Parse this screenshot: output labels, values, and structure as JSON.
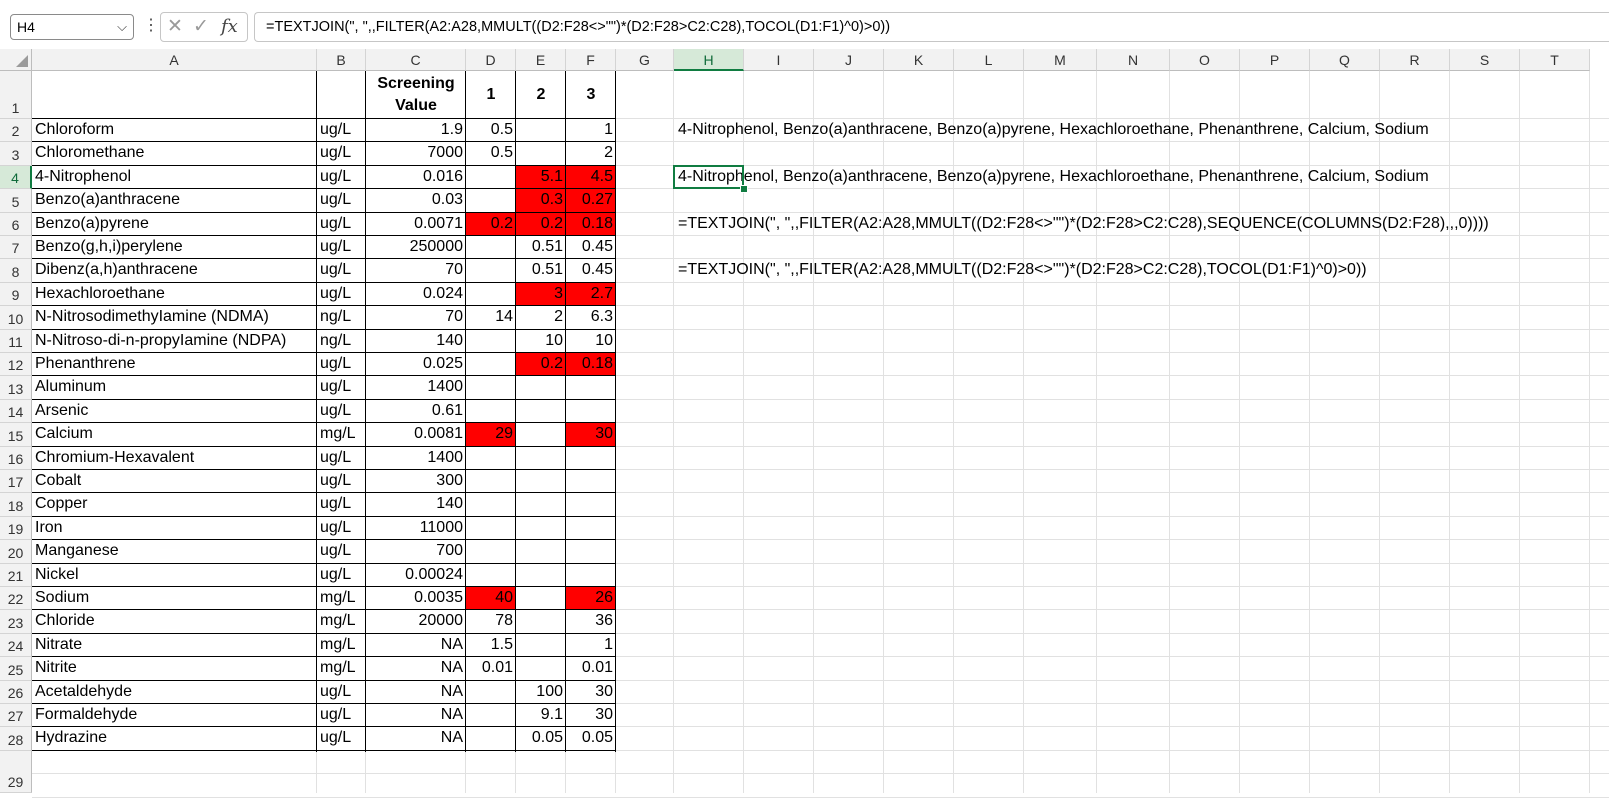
{
  "formula_bar": {
    "name_box": "H4",
    "name_box_chevron": "⌵",
    "dots": "⋮",
    "cancel_glyph": "✕",
    "enter_glyph": "✓",
    "fx_glyph": "fx",
    "formula": "=TEXTJOIN(\", \",,FILTER(A2:A28,MMULT((D2:F28<>\"\")*(D2:F28>C2:C28),TOCOL(D1:F1)^0)>0))"
  },
  "columns": [
    "A",
    "B",
    "C",
    "D",
    "E",
    "F",
    "G",
    "H",
    "I",
    "J",
    "K",
    "L",
    "M",
    "N",
    "O",
    "P",
    "Q",
    "R",
    "S",
    "T"
  ],
  "selected_cell": "H4",
  "header_row": {
    "c": "Screening Value",
    "d": "1",
    "e": "2",
    "f": "3"
  },
  "rows": [
    {
      "a": "Chloroform",
      "b": "ug/L",
      "c": "1.9",
      "d": "0.5",
      "e": "",
      "f": "1"
    },
    {
      "a": "Chloromethane",
      "b": "ug/L",
      "c": "7000",
      "d": "0.5",
      "e": "",
      "f": "2"
    },
    {
      "a": "4-Nitrophenol",
      "b": "ug/L",
      "c": "0.016",
      "d": "",
      "e": "5.1",
      "f": "4.5"
    },
    {
      "a": "Benzo(a)anthracene",
      "b": "ug/L",
      "c": "0.03",
      "d": "",
      "e": "0.3",
      "f": "0.27"
    },
    {
      "a": "Benzo(a)pyrene",
      "b": "ug/L",
      "c": "0.0071",
      "d": "0.2",
      "e": "0.2",
      "f": "0.18"
    },
    {
      "a": "Benzo(g,h,i)perylene",
      "b": "ug/L",
      "c": "250000",
      "d": "",
      "e": "0.51",
      "f": "0.45"
    },
    {
      "a": "Dibenz(a,h)anthracene",
      "b": "ug/L",
      "c": "70",
      "d": "",
      "e": "0.51",
      "f": "0.45"
    },
    {
      "a": "Hexachloroethane",
      "b": "ug/L",
      "c": "0.024",
      "d": "",
      "e": "3",
      "f": "2.7"
    },
    {
      "a": "N-NitrosodimethyIamine (NDMA)",
      "b": "ng/L",
      "c": "70",
      "d": "14",
      "e": "2",
      "f": "6.3"
    },
    {
      "a": "N-Nitroso-di-n-propyIamine (NDPA)",
      "b": "ng/L",
      "c": "140",
      "d": "",
      "e": "10",
      "f": "10"
    },
    {
      "a": "Phenanthrene",
      "b": "ug/L",
      "c": "0.025",
      "d": "",
      "e": "0.2",
      "f": "0.18"
    },
    {
      "a": "Aluminum",
      "b": "ug/L",
      "c": "1400",
      "d": "",
      "e": "",
      "f": ""
    },
    {
      "a": "Arsenic",
      "b": "ug/L",
      "c": "0.61",
      "d": "",
      "e": "",
      "f": ""
    },
    {
      "a": "Calcium",
      "b": "mg/L",
      "c": "0.0081",
      "d": "29",
      "e": "",
      "f": "30"
    },
    {
      "a": "Chromium-Hexavalent",
      "b": "ug/L",
      "c": "1400",
      "d": "",
      "e": "",
      "f": ""
    },
    {
      "a": "Cobalt",
      "b": "ug/L",
      "c": "300",
      "d": "",
      "e": "",
      "f": ""
    },
    {
      "a": "Copper",
      "b": "ug/L",
      "c": "140",
      "d": "",
      "e": "",
      "f": ""
    },
    {
      "a": "Iron",
      "b": "ug/L",
      "c": "11000",
      "d": "",
      "e": "",
      "f": ""
    },
    {
      "a": "Manganese",
      "b": "ug/L",
      "c": "700",
      "d": "",
      "e": "",
      "f": ""
    },
    {
      "a": "Nickel",
      "b": "ug/L",
      "c": "0.00024",
      "d": "",
      "e": "",
      "f": ""
    },
    {
      "a": "Sodium",
      "b": "mg/L",
      "c": "0.0035",
      "d": "40",
      "e": "",
      "f": "26"
    },
    {
      "a": "Chloride",
      "b": "mg/L",
      "c": "20000",
      "d": "78",
      "e": "",
      "f": "36"
    },
    {
      "a": "Nitrate",
      "b": "mg/L",
      "c": "NA",
      "d": "1.5",
      "e": "",
      "f": "1"
    },
    {
      "a": "Nitrite",
      "b": "mg/L",
      "c": "NA",
      "d": "0.01",
      "e": "",
      "f": "0.01"
    },
    {
      "a": "Acetaldehyde",
      "b": "ug/L",
      "c": "NA",
      "d": "",
      "e": "100",
      "f": "30"
    },
    {
      "a": "Formaldehyde",
      "b": "ug/L",
      "c": "NA",
      "d": "",
      "e": "9.1",
      "f": "30"
    },
    {
      "a": "Hydrazine",
      "b": "ug/L",
      "c": "NA",
      "d": "",
      "e": "0.05",
      "f": "0.05"
    }
  ],
  "highlight_color": "#ff0000",
  "highlighted_cells": [
    "E4",
    "F4",
    "E5",
    "F5",
    "D6",
    "E6",
    "F6",
    "E9",
    "F9",
    "E12",
    "F12",
    "D15",
    "F15",
    "D22",
    "F22"
  ],
  "h_column": {
    "h2": "4-Nitrophenol, Benzo(a)anthracene, Benzo(a)pyrene, Hexachloroethane, Phenanthrene, Calcium, Sodium",
    "h4": "4-Nitrophenol, Benzo(a)anthracene, Benzo(a)pyrene, Hexachloroethane, Phenanthrene, Calcium, Sodium",
    "h6": "=TEXTJOIN(\", \",,FILTER(A2:A28,MMULT((D2:F28<>\"\")*(D2:F28>C2:C28),SEQUENCE(COLUMNS(D2:F28),,,0))))",
    "h8": "=TEXTJOIN(\", \",,FILTER(A2:A28,MMULT((D2:F28<>\"\")*(D2:F28>C2:C28),TOCOL(D1:F1)^0)>0))"
  },
  "row_numbers": [
    "1",
    "2",
    "3",
    "4",
    "5",
    "6",
    "7",
    "8",
    "9",
    "10",
    "11",
    "12",
    "13",
    "14",
    "15",
    "16",
    "17",
    "18",
    "19",
    "20",
    "21",
    "22",
    "23",
    "24",
    "25",
    "26",
    "27",
    "28",
    "29"
  ]
}
